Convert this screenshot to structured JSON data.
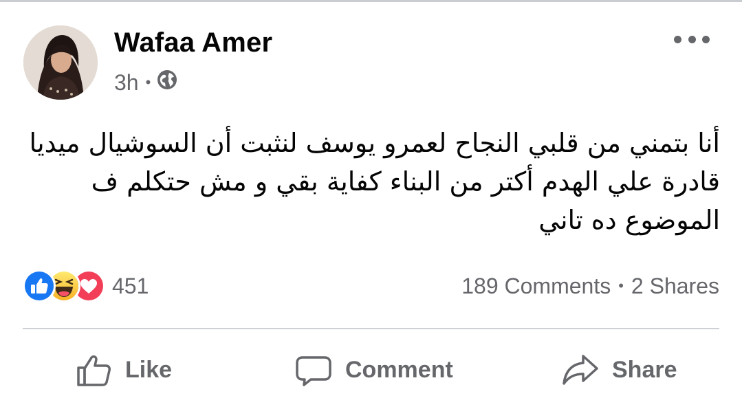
{
  "post": {
    "author": "Wafaa Amer",
    "time": "3h",
    "separator": "•",
    "audience_icon": "globe-icon",
    "more_icon": "more-options-icon",
    "text_lines": [
      "أنا بتمني من قلبي النجاح لعمرو يوسف لنثبت أن السوشيال ميديا",
      "قادرة علي الهدم أكتر من البناء كفاية بقي و مش حتكلم ف",
      "الموضوع ده تاني"
    ]
  },
  "stats": {
    "reaction_icons": [
      "like-reaction-icon",
      "haha-reaction-icon",
      "love-reaction-icon"
    ],
    "reaction_count": "451",
    "comments": "189 Comments",
    "separator": "•",
    "shares": "2 Shares"
  },
  "actions": {
    "like": {
      "label": "Like",
      "icon": "thumbs-up-icon"
    },
    "comment": {
      "label": "Comment",
      "icon": "comment-bubble-icon"
    },
    "share": {
      "label": "Share",
      "icon": "share-arrow-icon"
    }
  },
  "colors": {
    "like_blue": "#1877f2",
    "haha_yellow": "#f7b125",
    "love_red": "#f33e58",
    "secondary_text": "#65676b",
    "divider": "#ced0d4"
  }
}
